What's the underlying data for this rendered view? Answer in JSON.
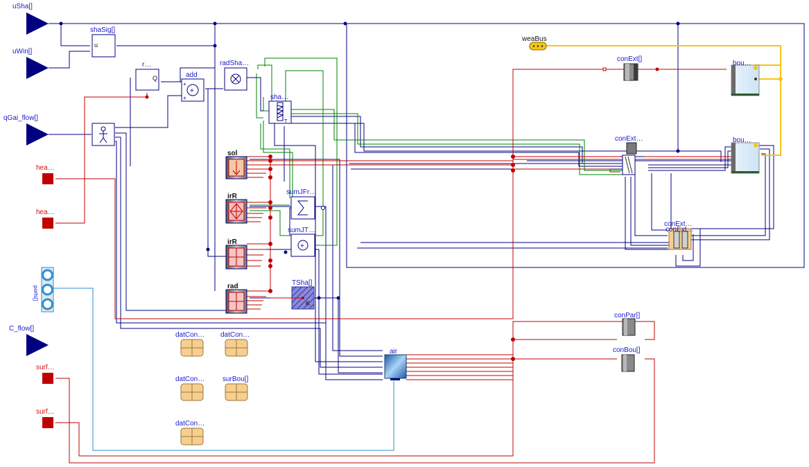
{
  "inputs": {
    "uSha": "uSha[]",
    "uWin": "uWin[]",
    "qGai_flow": "qGai_flow[]",
    "C_flow": "C_flow[]"
  },
  "heat_ports": {
    "hea1": "hea…",
    "hea2": "hea…",
    "surf1": "surf…",
    "surf2": "surf…"
  },
  "ports": {
    "weaBus": "weaBus",
    "ports_label": "ports[]"
  },
  "blocks": {
    "shaSig": "shaSig[]",
    "shaSig_inner": "u",
    "r": "r…",
    "r_inner": "Q",
    "add": "add",
    "radSha": "radSha…",
    "sha": "sha…",
    "sol": "sol",
    "irR1": "irR",
    "irR2": "irR",
    "rad": "rad",
    "sumJFr": "sumJFr…",
    "sumJT": "sumJT…",
    "TSha": "TSha[]",
    "TSha_inner": "K",
    "air": "air",
    "conExt1": "conExt[]",
    "conExt2": "conExt…",
    "conExt3": "conExt…",
    "conExt4": "conExt…",
    "bou1": "bou…",
    "bou2": "bou…",
    "conPar": "conPar[]",
    "conBou": "conBou[]"
  },
  "records": {
    "datCon1": "datCon…",
    "datCon2": "datCon…",
    "datCon3": "datCon…",
    "surBou": "surBou[]",
    "datCon4": "datCon…"
  },
  "colors": {
    "signal": "#000080",
    "heat": "#bf0000",
    "fluid": "#2a8fd6",
    "real": "#008000",
    "weather": "#f5c518"
  }
}
